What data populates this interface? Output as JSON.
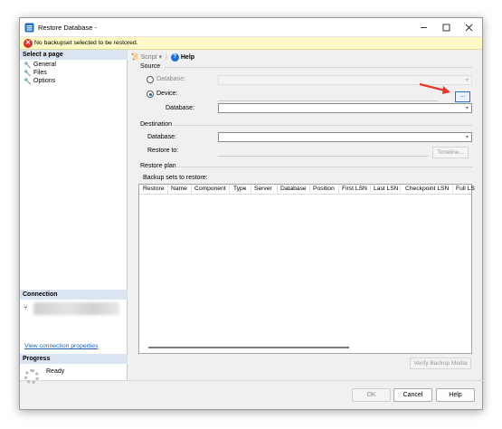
{
  "window": {
    "title": "Restore Database -"
  },
  "warning": {
    "text": "No backupset selected to be restored."
  },
  "left": {
    "select_page": "Select a page",
    "pages": [
      "General",
      "Files",
      "Options"
    ],
    "connection_header": "Connection",
    "connection_link": "View connection properties",
    "progress_header": "Progress",
    "progress_status": "Ready"
  },
  "toolbar": {
    "script_label": "Script",
    "script_dropdown": "▾",
    "help_label": "Help"
  },
  "source": {
    "label": "Source",
    "database_option": "Database:",
    "device_option": "Device:",
    "device_database_label": "Database:",
    "browse_label": "...",
    "selected_option": "Device"
  },
  "destination": {
    "label": "Destination",
    "database_label": "Database:",
    "restore_to_label": "Restore to:",
    "timeline_button": "Timeline..."
  },
  "restore_plan": {
    "label": "Restore plan",
    "backup_sets_label": "Backup sets to restore:",
    "columns": [
      "Restore",
      "Name",
      "Component",
      "Type",
      "Server",
      "Database",
      "Position",
      "First LSN",
      "Last LSN",
      "Checkpoint LSN",
      "Full LS"
    ]
  },
  "buttons": {
    "verify": "Verify Backup Media",
    "ok": "OK",
    "cancel": "Cancel",
    "help": "Help"
  },
  "colors": {
    "accent": "#1a5fb4",
    "warning_bg": "#fff9c8",
    "arrow": "#e23b2e",
    "section_bg": "#dbe5f1"
  }
}
